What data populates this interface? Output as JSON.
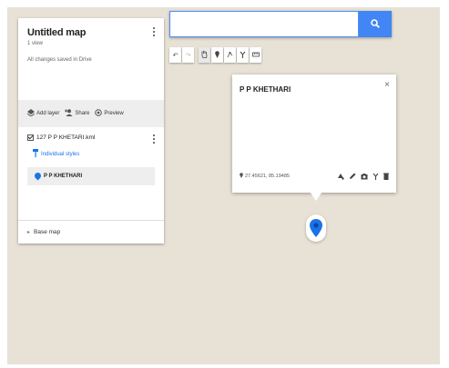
{
  "map": {
    "title": "Untitled map",
    "views": "1 view",
    "save_status": "All changes saved in Drive"
  },
  "actions": {
    "add_layer": "Add layer",
    "share": "Share",
    "preview": "Preview"
  },
  "layer": {
    "name": "127 P P KHETARI.kml",
    "styles_link": "Individual styles",
    "place": "P P KHETHARI"
  },
  "basemap": {
    "label": "Base map"
  },
  "search": {
    "value": "",
    "placeholder": ""
  },
  "toolbar": {
    "icons": [
      "undo-icon",
      "redo-icon",
      "hand-icon",
      "marker-icon",
      "line-icon",
      "route-icon",
      "ruler-icon"
    ]
  },
  "infowindow": {
    "title": "P P KHETHARI",
    "coords": "27.45621, 85.19485",
    "close": "×"
  },
  "colors": {
    "accent": "#4285f4",
    "link": "#1a73e8",
    "map_bg": "#e8e2d6"
  }
}
